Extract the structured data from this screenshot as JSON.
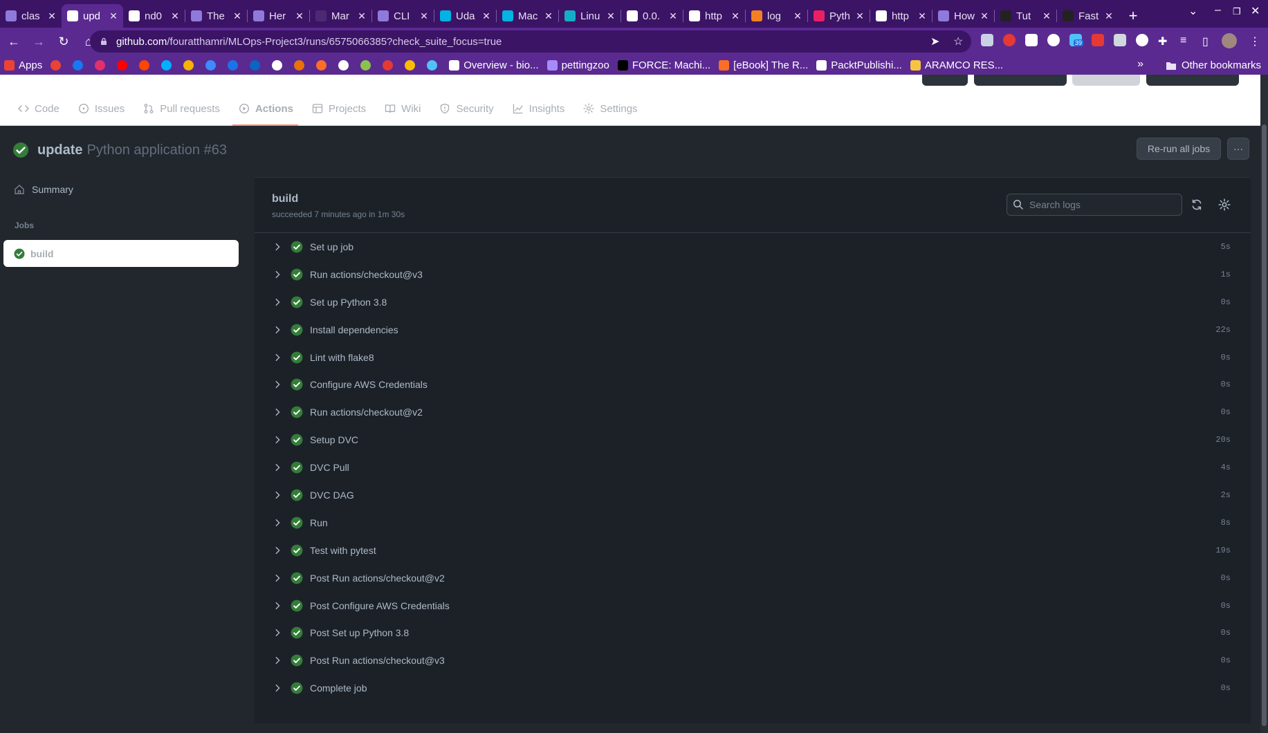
{
  "browser": {
    "tabs": [
      {
        "title": "clas",
        "icon": "heroku-icon",
        "color": "#8f7ad9"
      },
      {
        "title": "upd",
        "icon": "github-icon",
        "color": "#ffffff",
        "active": true
      },
      {
        "title": "nd0",
        "icon": "github-icon",
        "color": "#ffffff"
      },
      {
        "title": "The",
        "icon": "heroku-icon",
        "color": "#8f7ad9"
      },
      {
        "title": "Her",
        "icon": "heroku-icon",
        "color": "#8f7ad9"
      },
      {
        "title": "Mar",
        "icon": "page-icon",
        "color": "#4b2a73"
      },
      {
        "title": "CLI",
        "icon": "heroku-icon",
        "color": "#8f7ad9"
      },
      {
        "title": "Uda",
        "icon": "udacity-icon",
        "color": "#02b3e4"
      },
      {
        "title": "Mac",
        "icon": "udacity-icon",
        "color": "#02b3e4"
      },
      {
        "title": "Linu",
        "icon": "dvc-icon",
        "color": "#13adc7"
      },
      {
        "title": "0.0.",
        "icon": "globe-icon",
        "color": "#ffffff"
      },
      {
        "title": "http",
        "icon": "globe-icon",
        "color": "#ffffff"
      },
      {
        "title": "log",
        "icon": "stackoverflow-icon",
        "color": "#f48024"
      },
      {
        "title": "Pyth",
        "icon": "pydantic-icon",
        "color": "#e92063"
      },
      {
        "title": "http",
        "icon": "globe-icon",
        "color": "#ffffff"
      },
      {
        "title": "How",
        "icon": "heroku-icon",
        "color": "#8f7ad9"
      },
      {
        "title": "Tut",
        "icon": "github-icon",
        "color": "#222222"
      },
      {
        "title": "Fast",
        "icon": "github-icon",
        "color": "#222222"
      }
    ],
    "new_tab_label": "+",
    "url_host": "github.com",
    "url_path": "/fouratthamri/MLOps-Project3/runs/6575066385?check_suite_focus=true",
    "extensions_badge": "39",
    "bookmarks": [
      {
        "label": "Apps",
        "color": "#ea4335"
      },
      {
        "label": "",
        "color": "#ea4335"
      },
      {
        "label": "",
        "color": "#1877f2"
      },
      {
        "label": "",
        "color": "#e1306c"
      },
      {
        "label": "",
        "color": "#ff0000"
      },
      {
        "label": "",
        "color": "#ff4500"
      },
      {
        "label": "",
        "color": "#00b0ff"
      },
      {
        "label": "",
        "color": "#f5b400"
      },
      {
        "label": "",
        "color": "#3d8bfd"
      },
      {
        "label": "",
        "color": "#1a73e8"
      },
      {
        "label": "",
        "color": "#0a66c2"
      },
      {
        "label": "",
        "color": "#ffffff"
      },
      {
        "label": "",
        "color": "#e8710a"
      },
      {
        "label": "",
        "color": "#fc6d26"
      },
      {
        "label": "",
        "color": "#ffffff"
      },
      {
        "label": "",
        "color": "#8bc34a"
      },
      {
        "label": "",
        "color": "#e53935"
      },
      {
        "label": "",
        "color": "#fbbc04"
      },
      {
        "label": "",
        "color": "#4fc3f7"
      },
      {
        "label": "Overview - bio...",
        "color": "#ffffff"
      },
      {
        "label": "pettingzoo",
        "color": "#a78bfa"
      },
      {
        "label": "FORCE: Machi...",
        "color": "#000000"
      },
      {
        "label": "[eBook] The R...",
        "color": "#fc6d26"
      },
      {
        "label": "PacktPublishi...",
        "color": "#ffffff"
      },
      {
        "label": "ARAMCO RES...",
        "color": "#f5c542"
      }
    ],
    "more_bookmarks": "»",
    "other_bookmarks": "Other bookmarks"
  },
  "repo_nav": {
    "tabs": [
      {
        "label": "Code",
        "icon": "code-icon"
      },
      {
        "label": "Issues",
        "icon": "issue-icon"
      },
      {
        "label": "Pull requests",
        "icon": "pull-request-icon"
      },
      {
        "label": "Actions",
        "icon": "actions-play-icon",
        "active": true
      },
      {
        "label": "Projects",
        "icon": "table-icon"
      },
      {
        "label": "Wiki",
        "icon": "book-icon"
      },
      {
        "label": "Security",
        "icon": "shield-icon"
      },
      {
        "label": "Insights",
        "icon": "graph-icon"
      },
      {
        "label": "Settings",
        "icon": "gear-icon"
      }
    ]
  },
  "run": {
    "title": "update",
    "subtitle": "Python application #63",
    "rerun_label": "Re-run all jobs",
    "more_label": "···"
  },
  "sidebar": {
    "summary_label": "Summary",
    "jobs_heading": "Jobs",
    "job_label": "build"
  },
  "job": {
    "name": "build",
    "status": "succeeded 7 minutes ago in 1m 30s",
    "search_placeholder": "Search logs",
    "steps": [
      {
        "name": "Set up job",
        "duration": "5s"
      },
      {
        "name": "Run actions/checkout@v3",
        "duration": "1s"
      },
      {
        "name": "Set up Python 3.8",
        "duration": "0s"
      },
      {
        "name": "Install dependencies",
        "duration": "22s"
      },
      {
        "name": "Lint with flake8",
        "duration": "0s"
      },
      {
        "name": "Configure AWS Credentials",
        "duration": "0s"
      },
      {
        "name": "Run actions/checkout@v2",
        "duration": "0s"
      },
      {
        "name": "Setup DVC",
        "duration": "20s"
      },
      {
        "name": "DVC Pull",
        "duration": "4s"
      },
      {
        "name": "DVC DAG",
        "duration": "2s"
      },
      {
        "name": "Run",
        "duration": "8s"
      },
      {
        "name": "Test with pytest",
        "duration": "19s"
      },
      {
        "name": "Post Run actions/checkout@v2",
        "duration": "0s"
      },
      {
        "name": "Post Configure AWS Credentials",
        "duration": "0s"
      },
      {
        "name": "Post Set up Python 3.8",
        "duration": "0s"
      },
      {
        "name": "Post Run actions/checkout@v3",
        "duration": "0s"
      },
      {
        "name": "Complete job",
        "duration": "0s"
      }
    ]
  },
  "colors": {
    "success": "#347d39",
    "tab_strip": "#3b1466",
    "toolbar": "#5a2a91",
    "underline": "#fd8c73"
  }
}
